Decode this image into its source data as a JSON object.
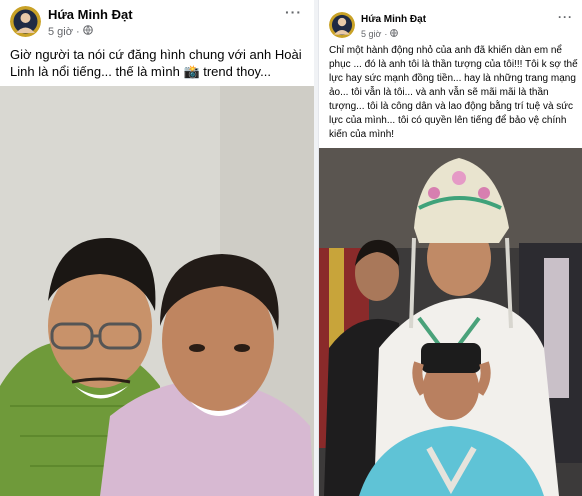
{
  "posts": [
    {
      "author": "Hứa Minh Đạt",
      "time": "5 giờ",
      "separator": "·",
      "privacy_icon": "globe-icon",
      "more_icon": "more-options-icon",
      "caption": "Giờ người ta nói cứ đăng hình chung với anh Hoài Linh là nổi tiếng... thế là mình 📸 trend thoy...",
      "photo": "selfie-two-men"
    },
    {
      "author": "Hứa Minh Đạt",
      "time": "5 giờ",
      "separator": "·",
      "privacy_icon": "globe-icon",
      "more_icon": "more-options-icon",
      "caption": "Chỉ một hành động nhỏ của anh đã khiến dàn em nể phục ... đó là anh tôi là thần tượng của tôi!!! Tôi k sợ thế lực hay sức mạnh đồng tiền... hay là những trang mạng ảo... tôi vẫn là tôi... và anh vẫn sẽ mãi mãi là thần tượng... tôi là công dân và lao động bằng trí tuệ và sức lực của mình... tôi có quyền lên tiếng để bảo vệ chính kiến của mình!",
      "photo": "costume-backstage"
    }
  ],
  "colors": {
    "text": "#050505",
    "meta": "#65676b",
    "divider": "#f0f2f5"
  }
}
